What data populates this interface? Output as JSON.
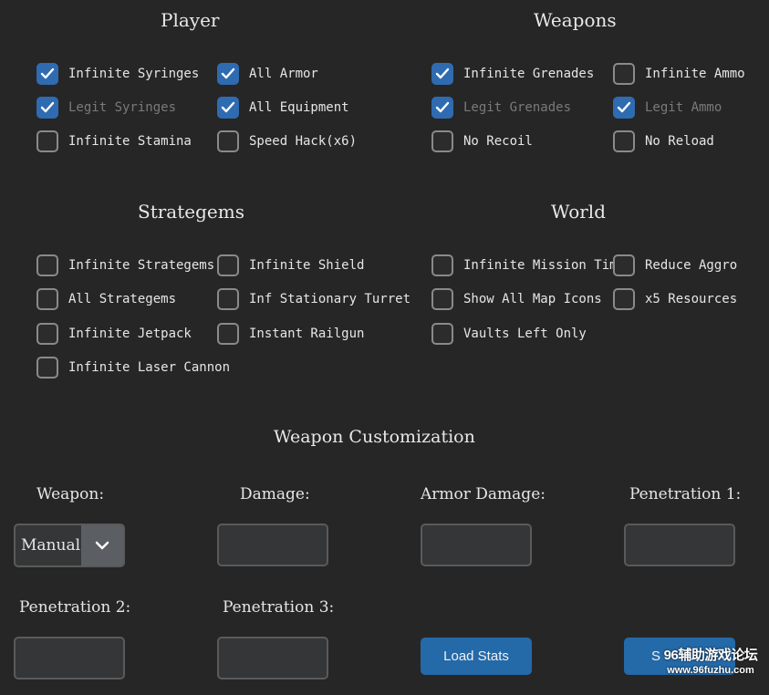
{
  "sections": {
    "player": "Player",
    "weapons": "Weapons",
    "strategems": "Strategems",
    "world": "World",
    "weapon_customization": "Weapon Customization"
  },
  "player": {
    "infinite_syringes": {
      "label": "Infinite Syringes",
      "checked": true
    },
    "all_armor": {
      "label": "All Armor",
      "checked": true
    },
    "legit_syringes": {
      "label": "Legit Syringes",
      "checked": true,
      "dim": true
    },
    "all_equipment": {
      "label": "All Equipment",
      "checked": true
    },
    "infinite_stamina": {
      "label": "Infinite Stamina",
      "checked": false
    },
    "speed_hack": {
      "label": "Speed Hack(x6)",
      "checked": false
    }
  },
  "weapons": {
    "infinite_grenades": {
      "label": "Infinite Grenades",
      "checked": true
    },
    "infinite_ammo": {
      "label": "Infinite Ammo",
      "checked": false
    },
    "legit_grenades": {
      "label": "Legit Grenades",
      "checked": true,
      "dim": true
    },
    "legit_ammo": {
      "label": "Legit Ammo",
      "checked": true,
      "dim": true
    },
    "no_recoil": {
      "label": "No Recoil",
      "checked": false
    },
    "no_reload": {
      "label": "No Reload",
      "checked": false
    }
  },
  "strategems": {
    "infinite_strategems": {
      "label": "Infinite Strategems",
      "checked": false
    },
    "infinite_shield": {
      "label": "Infinite Shield",
      "checked": false
    },
    "all_strategems": {
      "label": "All Strategems",
      "checked": false
    },
    "inf_stationary_turret": {
      "label": "Inf Stationary Turret",
      "checked": false
    },
    "infinite_jetpack": {
      "label": "Infinite Jetpack",
      "checked": false
    },
    "instant_railgun": {
      "label": "Instant Railgun",
      "checked": false
    },
    "infinite_laser_cannon": {
      "label": "Infinite Laser Cannon",
      "checked": false
    }
  },
  "world": {
    "infinite_mission_time": {
      "label": "Infinite Mission Time",
      "checked": false
    },
    "reduce_aggro": {
      "label": "Reduce Aggro",
      "checked": false
    },
    "show_all_map_icons": {
      "label": "Show All Map Icons",
      "checked": false
    },
    "x5_resources": {
      "label": "x5 Resources",
      "checked": false
    },
    "vaults_left_only": {
      "label": "Vaults Left Only",
      "checked": false
    }
  },
  "customization": {
    "weapon_label": "Weapon:",
    "weapon_value": "Manual",
    "damage_label": "Damage:",
    "damage_value": "",
    "armor_damage_label": "Armor Damage:",
    "armor_damage_value": "",
    "penetration1_label": "Penetration 1:",
    "penetration1_value": "",
    "penetration2_label": "Penetration 2:",
    "penetration2_value": "",
    "penetration3_label": "Penetration 3:",
    "penetration3_value": "",
    "load_stats_label": "Load Stats",
    "set_label": "S"
  },
  "watermark": {
    "line1": "96辅助游戏论坛",
    "line2": "www.96fuzhu.com"
  },
  "colors": {
    "background": "#262626",
    "accent": "#2f6bb0",
    "button": "#2469a8"
  },
  "icons": {
    "check": "check-icon",
    "dropdown": "chevron-down-icon"
  }
}
